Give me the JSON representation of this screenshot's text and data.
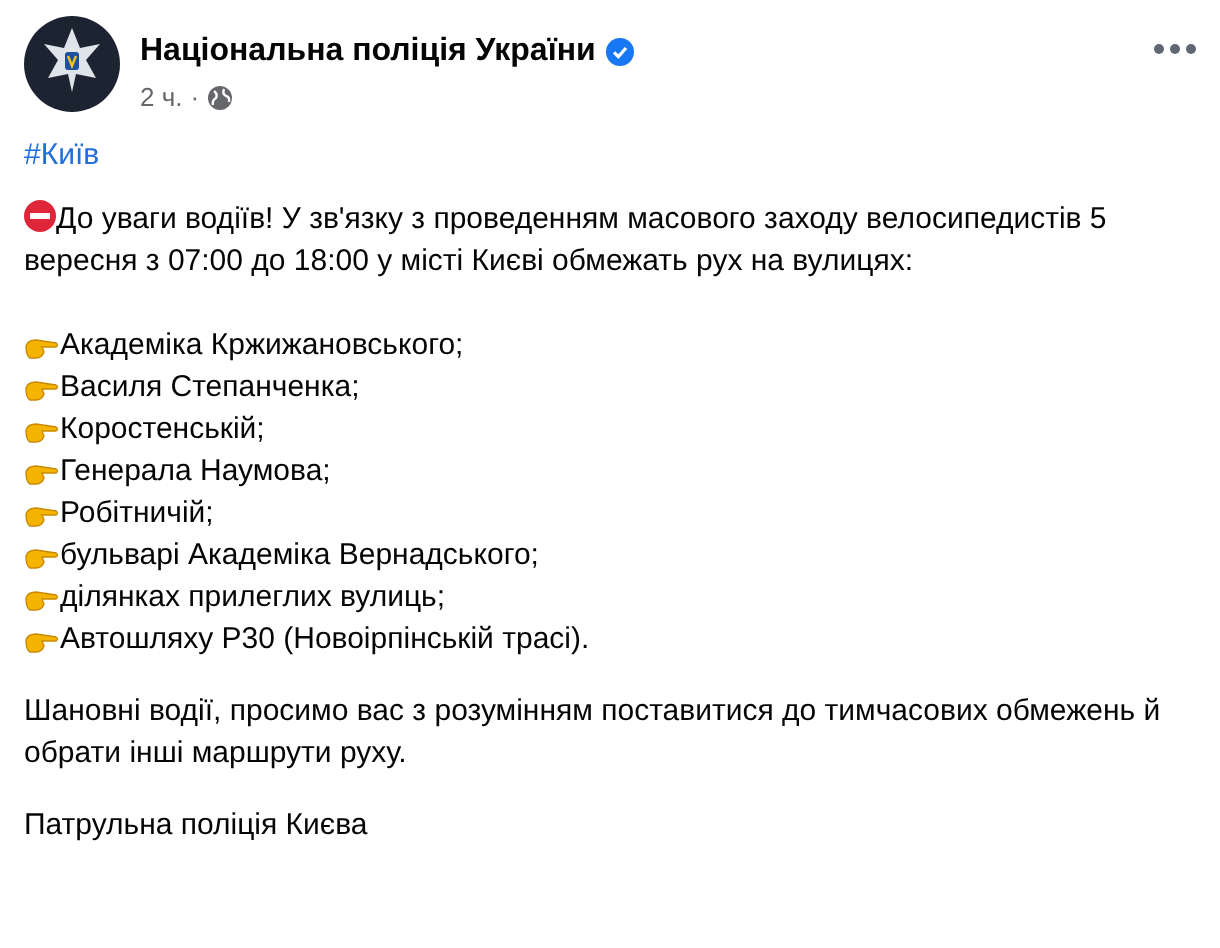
{
  "post": {
    "author": "Національна поліція України",
    "verified": true,
    "time": "2 ч.",
    "separator": "·",
    "hashtag": "#Київ",
    "intro": "До уваги водіїв! У зв'язку з проведенням масового заходу велосипедистів 5 вересня з 07:00 до 18:00 у місті Києві обмежать рух на вулицях:",
    "streets": [
      "Академіка Кржижановського;",
      "Василя Степанченка;",
      "Коростенській;",
      "Генерала Наумова;",
      "Робітничій;",
      "бульварі Академіка Вернадського;",
      "ділянках прилеглих вулиць;",
      "Автошляху Р30 (Новоірпінській трасі)."
    ],
    "appeal": "Шановні водії, просимо вас з розумінням поставитися до тимчасових обмежень й обрати інші маршрути руху.",
    "signature": "Патрульна поліція Києва"
  }
}
